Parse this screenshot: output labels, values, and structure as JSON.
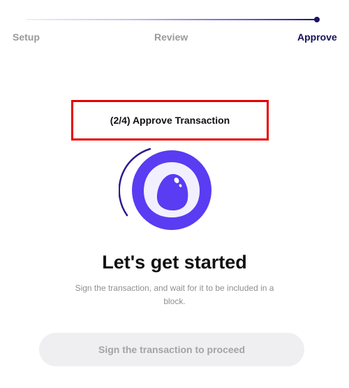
{
  "stepper": {
    "steps": [
      {
        "label": "Setup",
        "state": "done"
      },
      {
        "label": "Review",
        "state": "done"
      },
      {
        "label": "Approve",
        "state": "current"
      }
    ],
    "progress": 1.0,
    "colors": {
      "current": "#15105a",
      "inactive": "#9a9a9a"
    }
  },
  "title_box": {
    "text": "(2/4) Approve Transaction",
    "highlight_color": "#e60000"
  },
  "logo": {
    "icon": "wallet-drop-logo-icon",
    "circle_color": "#5a3cf2",
    "ring_color": "#f2f0ff"
  },
  "main": {
    "heading": "Let's get started",
    "subtext": "Sign the transaction, and wait for it to be included in a block."
  },
  "cta": {
    "label": "Sign the transaction to proceed",
    "enabled": false
  }
}
